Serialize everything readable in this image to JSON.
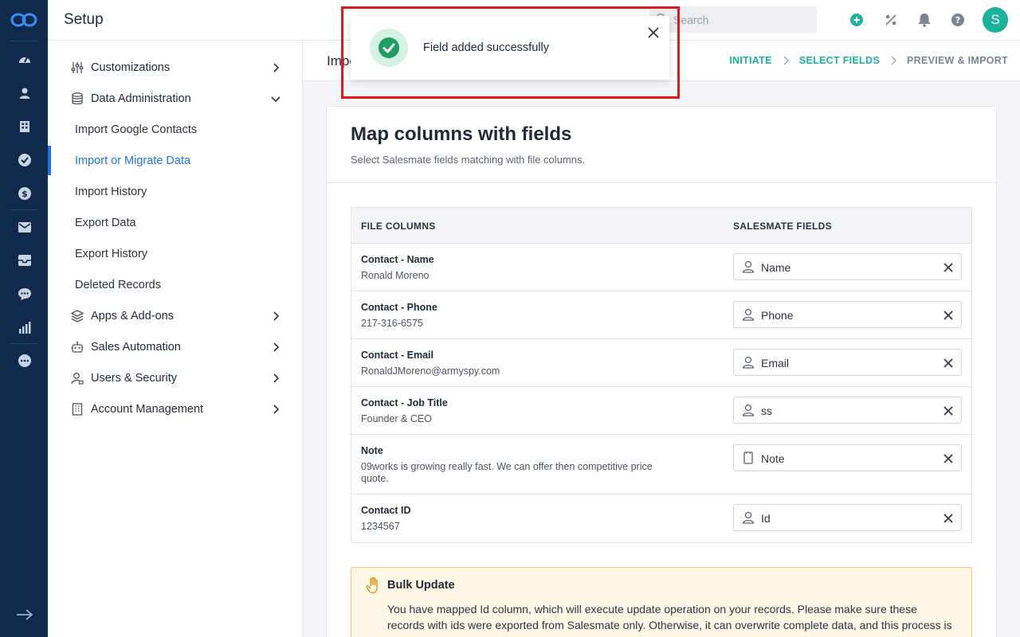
{
  "rail": {
    "icons": [
      "logo-icon",
      "dashboard-icon",
      "contacts-icon",
      "companies-icon",
      "tasks-icon",
      "deals-icon",
      "email-icon",
      "inbox-icon",
      "chat-icon",
      "reports-icon",
      "more-icon",
      "collapse-arrow-icon"
    ]
  },
  "header": {
    "title": "Setup",
    "search_placeholder": "Search",
    "avatar_initial": "S"
  },
  "sidebar": {
    "items": [
      {
        "label": "Customizations",
        "icon": "sliders-icon",
        "expanded": false
      },
      {
        "label": "Data Administration",
        "icon": "database-icon",
        "expanded": true
      },
      {
        "label": "Apps & Add-ons",
        "icon": "layers-icon",
        "expanded": false
      },
      {
        "label": "Sales Automation",
        "icon": "robot-icon",
        "expanded": false
      },
      {
        "label": "Users & Security",
        "icon": "user-lock-icon",
        "expanded": false
      },
      {
        "label": "Account Management",
        "icon": "building-icon",
        "expanded": false
      }
    ],
    "sub_items": [
      {
        "label": "Import Google Contacts",
        "active": false
      },
      {
        "label": "Import or Migrate Data",
        "active": true
      },
      {
        "label": "Import History",
        "active": false
      },
      {
        "label": "Export Data",
        "active": false
      },
      {
        "label": "Export History",
        "active": false
      },
      {
        "label": "Deleted Records",
        "active": false
      }
    ]
  },
  "page": {
    "title": "Impo",
    "steps": [
      "INITIATE",
      "SELECT FIELDS",
      "PREVIEW & IMPORT"
    ],
    "card_title": "Map columns with fields",
    "card_subtitle": "Select Salesmate fields matching with file columns.",
    "table": {
      "headers": [
        "FILE COLUMNS",
        "SALESMATE FIELDS"
      ],
      "rows": [
        {
          "column": "Contact - Name",
          "sample": "Ronald Moreno",
          "field": "Name",
          "field_icon": "user-icon"
        },
        {
          "column": "Contact - Phone",
          "sample": "217-316-6575",
          "field": "Phone",
          "field_icon": "user-icon"
        },
        {
          "column": "Contact - Email",
          "sample": "RonaldJMoreno@armyspy.com",
          "field": "Email",
          "field_icon": "user-icon"
        },
        {
          "column": "Contact - Job Title",
          "sample": "Founder & CEO",
          "field": "ss",
          "field_icon": "user-icon"
        },
        {
          "column": "Note",
          "sample": "09works is growing really fast. We can offer then competitive price quote.",
          "field": "Note",
          "field_icon": "note-icon"
        },
        {
          "column": "Contact ID",
          "sample": "1234567",
          "field": "Id",
          "field_icon": "user-icon"
        }
      ]
    },
    "bulk": {
      "title": "Bulk Update",
      "text": "You have mapped Id column, which will execute update operation on your records. Please make sure these records with ids were exported from Salesmate only. Otherwise, it can overwrite complete data, and this process is irreversible."
    }
  },
  "toast": {
    "message": "Field added successfully"
  },
  "colors": {
    "rail": "#0f2a4a",
    "accent_blue": "#1a73e8",
    "accent_green": "#1bb39c",
    "success": "#1e9c62",
    "highlight_frame": "#e1181c",
    "warning_bg": "#fff8e6"
  }
}
